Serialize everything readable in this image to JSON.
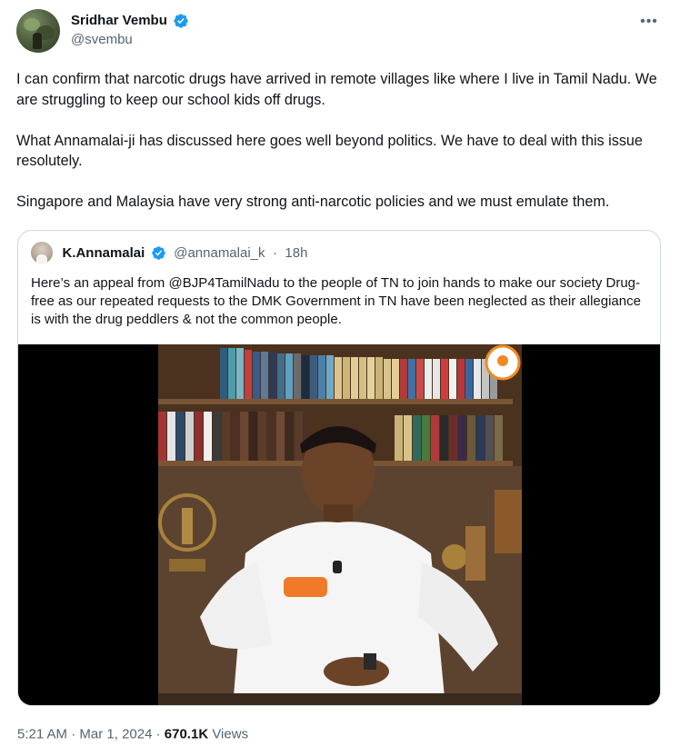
{
  "author": {
    "display_name": "Sridhar Vembu",
    "handle": "@svembu"
  },
  "more_icon": "more-horizontal-icon",
  "tweet": {
    "paragraphs": [
      "I can confirm that narcotic drugs have arrived in remote villages like where I live in Tamil Nadu. We are struggling to keep our school kids off drugs.",
      "What Annamalai-ji has discussed here goes well beyond politics. We have to deal with this issue resolutely.",
      "Singapore and Malaysia have very strong anti-narcotic policies and we must emulate them."
    ]
  },
  "quoted": {
    "display_name": "K.Annamalai",
    "handle": "@annamalai_k",
    "separator": "·",
    "time": "18h",
    "text": "Here’s an appeal from @BJP4TamilNadu to the people of TN to join hands to make our society Drug-free as our repeated requests to the DMK Government in TN have been neglected as their allegiance is with the drug peddlers & not the common people."
  },
  "footer": {
    "time": "5:21 AM",
    "dot1": "·",
    "date": "Mar 1, 2024",
    "dot2": "·",
    "views_count": "670.1K",
    "views_label": "Views"
  },
  "colors": {
    "verified_blue": "#1d9bf0",
    "text_primary": "#0f1419",
    "text_secondary": "#536471",
    "border": "#cfd9de"
  }
}
